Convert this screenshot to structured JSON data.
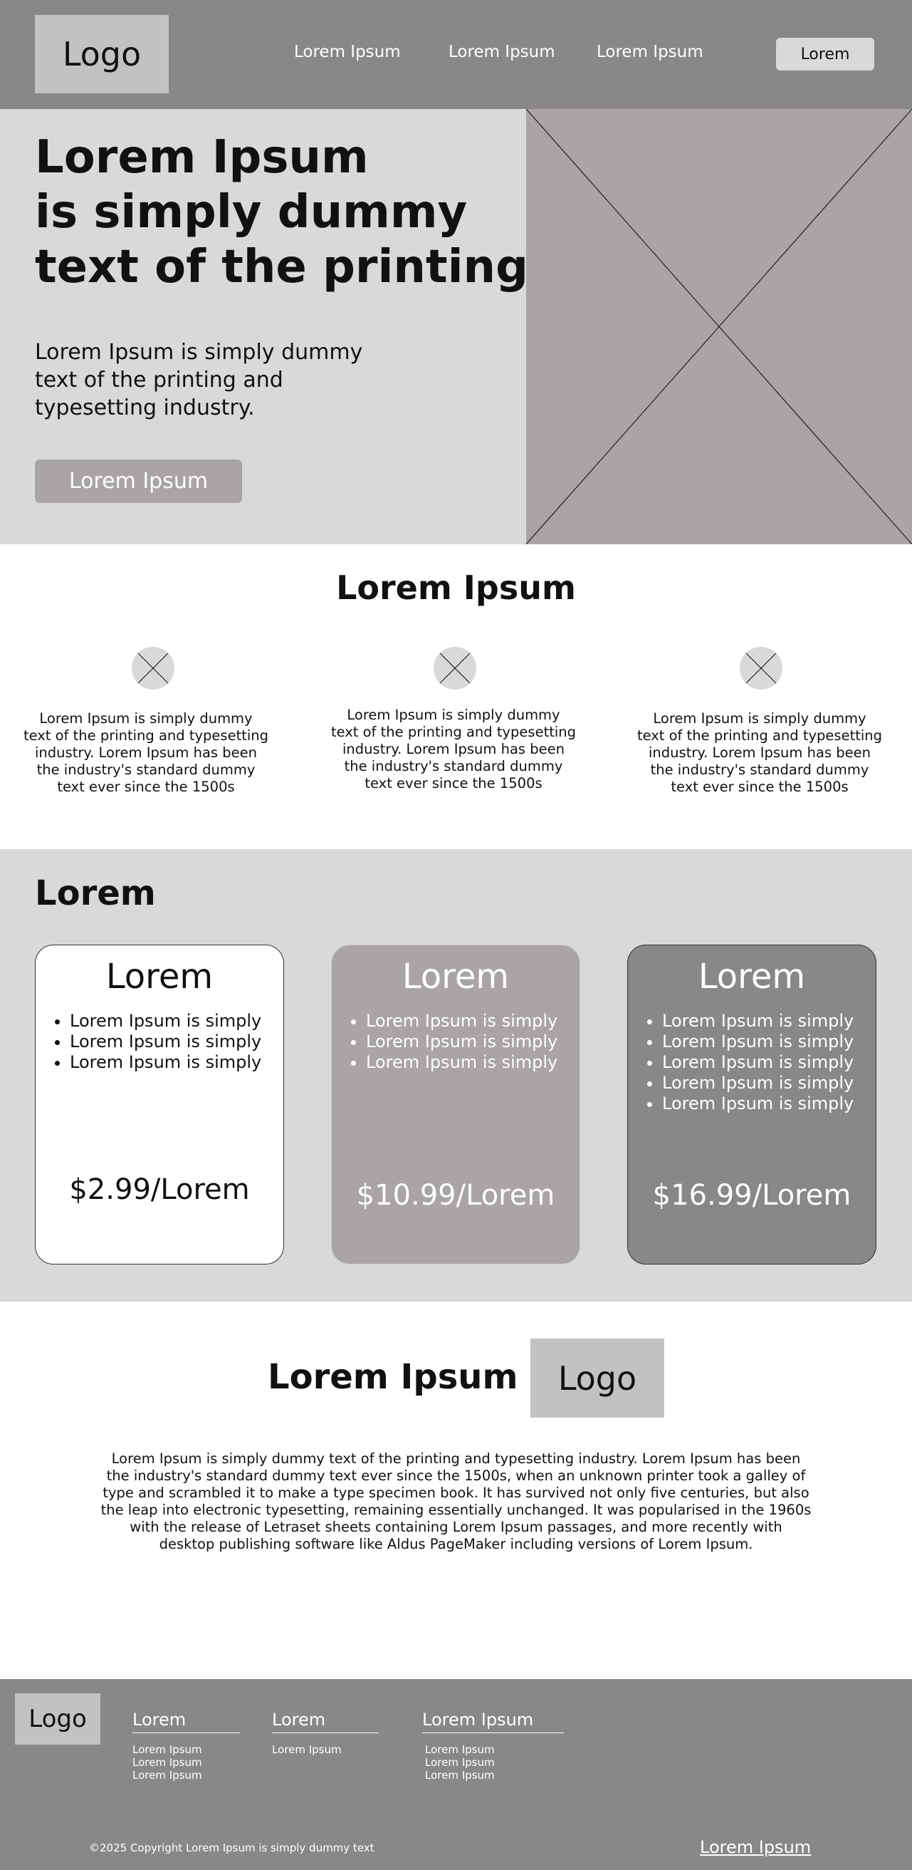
{
  "header": {
    "logo": "Logo",
    "nav": [
      "Lorem Ipsum",
      "Lorem Ipsum",
      "Lorem Ipsum"
    ],
    "button": "Lorem"
  },
  "hero": {
    "title_lines": [
      "Lorem Ipsum",
      "is simply dummy",
      "text of the printing"
    ],
    "subtitle_lines": [
      "Lorem Ipsum is simply dummy",
      "text of the printing and",
      "typesetting industry."
    ],
    "button": "Lorem Ipsum",
    "image_icon": "image-placeholder-icon"
  },
  "features": {
    "title": "Lorem Ipsum",
    "items": [
      {
        "icon": "image-placeholder-icon",
        "lines": [
          "Lorem Ipsum is simply dummy",
          "text of the printing and typesetting",
          "industry. Lorem Ipsum has been",
          "the industry's standard dummy",
          "text ever since the 1500s"
        ]
      },
      {
        "icon": "image-placeholder-icon",
        "lines": [
          "Lorem Ipsum is simply dummy",
          "text of the printing and typesetting",
          "industry. Lorem Ipsum has been",
          "the industry's standard dummy",
          "text ever since the 1500s"
        ]
      },
      {
        "icon": "image-placeholder-icon",
        "lines": [
          "Lorem Ipsum is simply dummy",
          "text of the printing and typesetting",
          "industry. Lorem Ipsum has been",
          "the industry's standard dummy",
          "text ever since the 1500s"
        ]
      }
    ]
  },
  "pricing": {
    "title": "Lorem",
    "cards": [
      {
        "title": "Lorem",
        "items": [
          "Lorem Ipsum is simply",
          "Lorem Ipsum is simply",
          "Lorem Ipsum is simply"
        ],
        "price": "$2.99/Lorem"
      },
      {
        "title": "Lorem",
        "items": [
          "Lorem Ipsum is simply",
          "Lorem Ipsum is simply",
          "Lorem Ipsum is simply"
        ],
        "price": "$10.99/Lorem"
      },
      {
        "title": "Lorem",
        "items": [
          "Lorem Ipsum is simply",
          "Lorem Ipsum is simply",
          "Lorem Ipsum is simply",
          "Lorem Ipsum is simply",
          "Lorem Ipsum is simply"
        ],
        "price": "$16.99/Lorem"
      }
    ]
  },
  "about": {
    "title": "Lorem Ipsum",
    "logo": "Logo",
    "text_lines": [
      "Lorem Ipsum is simply dummy text of the printing and typesetting industry. Lorem Ipsum has been",
      "the industry's standard dummy text ever since the 1500s, when an unknown printer took a galley of",
      "type and scrambled it to make a type specimen book. It has survived not only five centuries, but also",
      "the leap into electronic typesetting, remaining essentially unchanged. It was popularised in the 1960s",
      "with the release of Letraset sheets containing Lorem Ipsum passages, and more recently with",
      "desktop publishing software like Aldus PageMaker including versions of Lorem Ipsum."
    ]
  },
  "footer": {
    "logo": "Logo",
    "columns": [
      {
        "heading": "Lorem",
        "items": [
          "Lorem Ipsum",
          "Lorem Ipsum",
          "Lorem Ipsum"
        ]
      },
      {
        "heading": "Lorem",
        "items": [
          "Lorem Ipsum"
        ]
      },
      {
        "heading": "Lorem Ipsum",
        "items": [
          "Lorem Ipsum",
          "Lorem Ipsum",
          "Lorem Ipsum"
        ]
      }
    ],
    "copyright": "©2025 Copyright Lorem Ipsum is simply dummy text",
    "link": "Lorem Ipsum"
  },
  "colors": {
    "header_bg": "#8a8787",
    "hero_bg": "#d9d9d9",
    "placeholder": "#a8a5a4",
    "logo_box": "#c2c2c2"
  }
}
